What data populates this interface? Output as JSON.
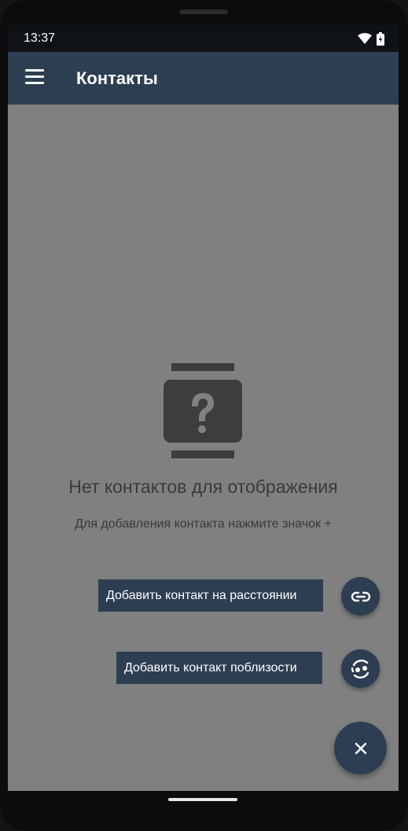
{
  "status_bar": {
    "time": "13:37"
  },
  "app_bar": {
    "title": "Контакты"
  },
  "empty_state": {
    "title": "Нет контактов для отображения",
    "subtitle": "Для добавления контакта нажмите значок +"
  },
  "fab_menu": {
    "add_remote_label": "Добавить контакт на расстоянии",
    "add_nearby_label": "Добавить контакт поблизости",
    "close_symbol": "×"
  },
  "colors": {
    "app_bar": "#2d3e52",
    "scrim": "#808080",
    "status_bar": "#0f1318"
  }
}
